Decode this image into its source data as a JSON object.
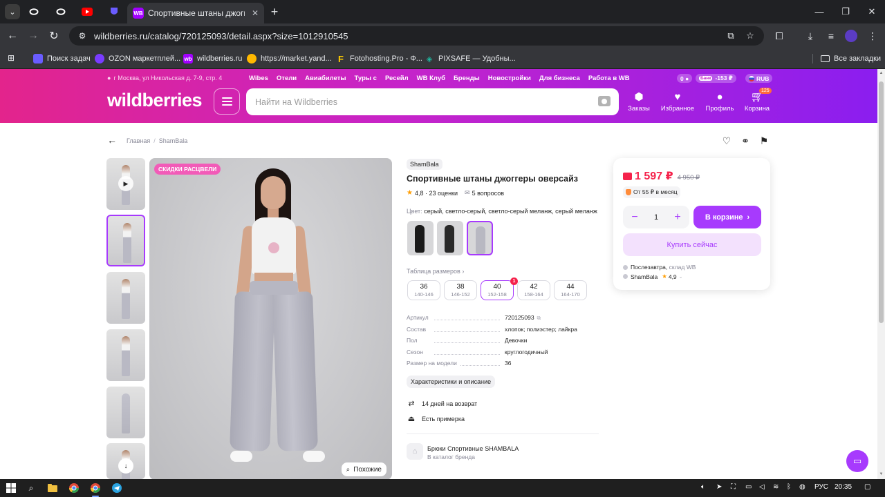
{
  "browser": {
    "tab_title": "Спортивные штаны джоггеры",
    "tab_favicon": "WB",
    "url": "wildberries.ru/catalog/720125093/detail.aspx?size=1012910545",
    "bookmarks": [
      {
        "label": "Поиск задач",
        "icon": "logo-icon",
        "color": "#6a5cff"
      },
      {
        "label": "OZON маркетплей...",
        "icon": "ozon-icon",
        "color": "#7a3cff"
      },
      {
        "label": "wildberries.ru",
        "icon": "wb-icon",
        "color": "#a200ff"
      },
      {
        "label": "https://market.yand...",
        "icon": "market-icon",
        "color": "#ffb800"
      },
      {
        "label": "Fotohosting.Pro - Ф...",
        "icon": "fotohosting-icon",
        "color": "#ffcc00"
      },
      {
        "label": "PIXSAFE — Удобны...",
        "icon": "pixsafe-icon",
        "color": "#1fb8a0"
      }
    ],
    "all_bookmarks": "Все закладки"
  },
  "wb": {
    "address": "г Москва, ул Никольская д. 7-9, стр. 4",
    "topnav": [
      "Wibes",
      "Отели",
      "Авиабилеты",
      "Туры с",
      "Ресейл",
      "WB Клуб",
      "Бренды",
      "Новостройки",
      "Для бизнеса",
      "Работа в WB"
    ],
    "wallet_zero": "0",
    "bank_label": "Банк",
    "bank_balance": "-153 ₽",
    "currency": "RUB",
    "logo": "wildberries",
    "search_placeholder": "Найти на Wildberries",
    "nav": {
      "orders": "Заказы",
      "favorites": "Избранное",
      "profile": "Профиль",
      "cart": "Корзина",
      "cart_count": "125"
    },
    "accent_color": "#a73afd"
  },
  "breadcrumb": [
    "Главная",
    "ShamBala"
  ],
  "product": {
    "promo_badge": "СКИДКИ РАСЦВЕЛИ",
    "similar_label": "Похожие",
    "brand": "ShamBala",
    "title": "Спортивные штаны джоггеры оверсайз",
    "rating": "4,8",
    "reviews": "· 23 оценки",
    "questions": "5 вопросов",
    "color_label": "Цвет:",
    "color_value": "серый, светло-серый, светло-серый меланж, серый меланж",
    "size_table_label": "Таблица размеров",
    "sizes": [
      {
        "size": "36",
        "range": "140-146"
      },
      {
        "size": "38",
        "range": "146-152"
      },
      {
        "size": "40",
        "range": "152-158"
      },
      {
        "size": "42",
        "range": "158-164"
      },
      {
        "size": "44",
        "range": "164-170"
      }
    ],
    "selected_size_badge": "1",
    "specs": [
      {
        "key": "Артикул",
        "value": "720125093"
      },
      {
        "key": "Состав",
        "value": "хлопок; полиэстер; лайкра"
      },
      {
        "key": "Пол",
        "value": "Девочки"
      },
      {
        "key": "Сезон",
        "value": "круглогодичный"
      },
      {
        "key": "Размер на модели",
        "value": "36"
      }
    ],
    "chars_button": "Характеристики и описание",
    "perks": [
      "14 дней на возврат",
      "Есть примерка"
    ],
    "brand_block_name": "Брюки Спортивные SHAMBALA",
    "brand_block_link": "В каталог бренда"
  },
  "buy": {
    "price": "1 597 ₽",
    "old_price": "4 950 ₽",
    "installment": "От 55 ₽ в месяц",
    "quantity": "1",
    "in_cart_label": "В корзине",
    "buy_now_label": "Купить сейчас",
    "delivery": "Послезавтра,",
    "warehouse": "склад WB",
    "seller": "ShamBala",
    "seller_rating": "4,9"
  },
  "taskbar": {
    "lang": "РУС",
    "time": "20:35"
  }
}
